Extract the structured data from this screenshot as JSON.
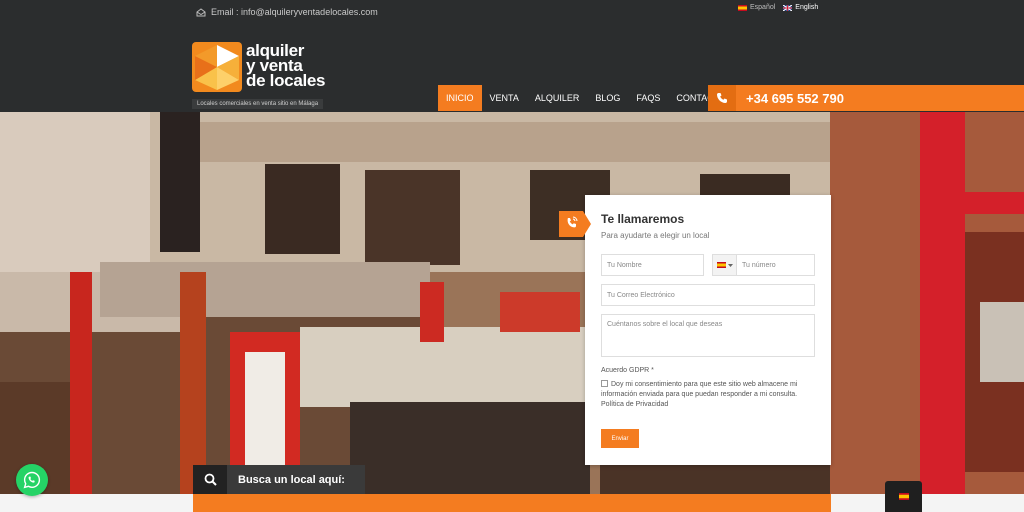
{
  "topbar": {
    "email": "Email : info@alquileryventadelocales.com",
    "lang_es": "Español",
    "lang_en": "English"
  },
  "brand": {
    "line1": "alquiler",
    "line2": "y venta",
    "line3": "de locales",
    "tagline": "Locales comerciales en venta sitio en Málaga"
  },
  "nav": {
    "items": [
      "INICIO",
      "VENTA",
      "ALQUILER",
      "BLOG",
      "FAQS",
      "CONTACTO"
    ]
  },
  "phone": "+34 695 552 790",
  "form": {
    "title": "Te llamaremos",
    "subtitle": "Para ayudarte a elegir un local",
    "name_placeholder": "Tu Nombre",
    "phone_placeholder": "Tu número",
    "email_placeholder": "Tu Correo Electrónico",
    "message_placeholder": "Cuéntanos sobre el local que deseas",
    "gdpr_label": "Acuerdo GDPR *",
    "consent_text": "Doy mi consentimiento para que este sitio web almacene mi información enviada para que puedan responder a mi consulta. Política de Privacidad",
    "submit_label": "Enviar"
  },
  "search": {
    "label": "Busca un local aquí:"
  },
  "icons": {
    "email": "envelope-icon",
    "phone": "phone-icon",
    "search": "search-icon",
    "whatsapp": "whatsapp-icon",
    "callback": "phone-call-icon"
  },
  "colors": {
    "accent": "#f47c20",
    "header_bg": "#2b2d2e",
    "whatsapp": "#25d366"
  }
}
